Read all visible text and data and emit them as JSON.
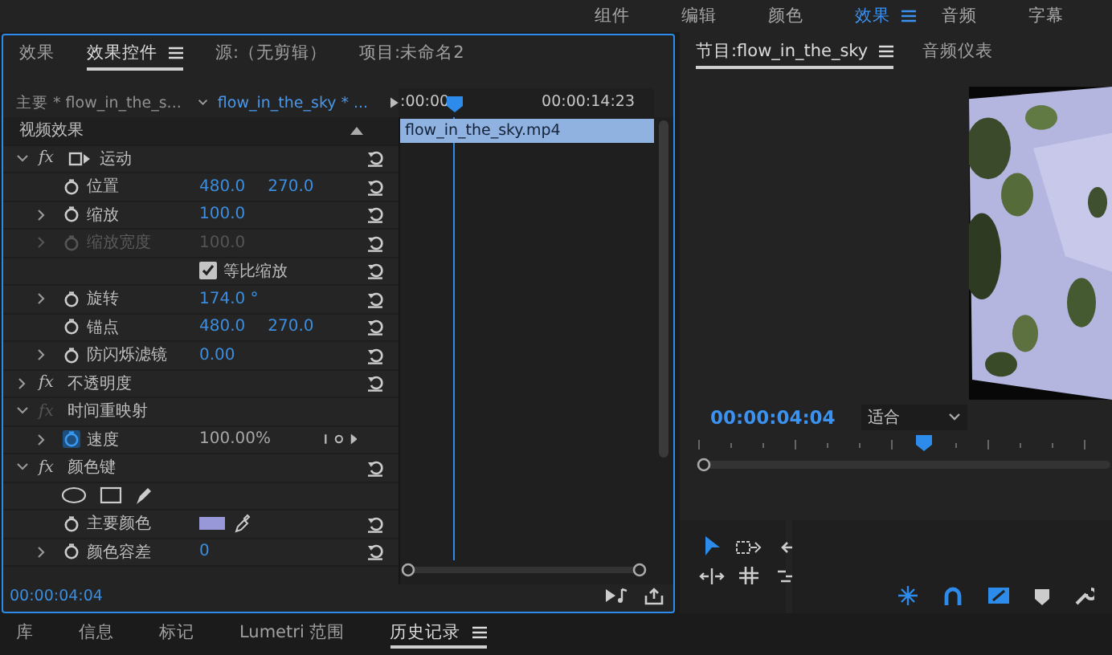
{
  "workspaces": [
    {
      "label": "组件",
      "selected": false
    },
    {
      "label": "编辑",
      "selected": false
    },
    {
      "label": "颜色",
      "selected": false
    },
    {
      "label": "效果",
      "selected": true
    },
    {
      "label": "音频",
      "selected": false
    },
    {
      "label": "字幕",
      "selected": false
    }
  ],
  "effect_panel": {
    "tabs": [
      {
        "label": "效果",
        "selected": false
      },
      {
        "label": "效果控件",
        "selected": true
      },
      {
        "label": "源:（无剪辑）",
        "selected": false
      },
      {
        "label": "项目:未命名2",
        "selected": false
      }
    ],
    "master_clip": "主要 * flow_in_the_s...",
    "sequence_clip": "flow_in_the_sky * ...",
    "ruler_start": ":00:00",
    "ruler_end": "00:00:14:23",
    "clip_name": "flow_in_the_sky.mp4",
    "rows": [
      {
        "kind": "header",
        "label": "视频效果"
      },
      {
        "kind": "effect",
        "label": "运动",
        "badge": "fx",
        "expanded": true,
        "fx_active": true,
        "transform": true,
        "reset": true
      },
      {
        "kind": "param",
        "label": "位置",
        "values": [
          "480.0",
          "270.0"
        ],
        "keyframing": false,
        "disabled": false,
        "reset": true
      },
      {
        "kind": "param",
        "label": "缩放",
        "expanded": false,
        "values": [
          "100.0"
        ],
        "keyframing": false,
        "disabled": false,
        "reset": true
      },
      {
        "kind": "param",
        "label": "缩放宽度",
        "expanded": false,
        "values": [
          "100.0"
        ],
        "keyframing": false,
        "disabled": true,
        "reset": true
      },
      {
        "kind": "checkbox",
        "label": "等比缩放",
        "checked": true,
        "reset": true
      },
      {
        "kind": "param",
        "label": "旋转",
        "expanded": false,
        "values": [
          "174.0 °"
        ],
        "keyframing": false,
        "disabled": false,
        "reset": true
      },
      {
        "kind": "param",
        "label": "锚点",
        "values": [
          "480.0",
          "270.0"
        ],
        "keyframing": false,
        "disabled": false,
        "reset": true
      },
      {
        "kind": "param",
        "label": "防闪烁滤镜",
        "expanded": false,
        "values": [
          "0.00"
        ],
        "keyframing": false,
        "disabled": false,
        "reset": true
      },
      {
        "kind": "effect",
        "label": "不透明度",
        "badge": "fx",
        "expanded": false,
        "fx_active": true,
        "transform": false,
        "reset": true
      },
      {
        "kind": "effect",
        "label": "时间重映射",
        "badge": "fx",
        "expanded": true,
        "fx_active": false,
        "transform": false,
        "reset": false
      },
      {
        "kind": "speed",
        "label": "速度",
        "expanded": false,
        "values": [
          "100.00%"
        ],
        "keyframing": true,
        "reset": false
      },
      {
        "kind": "effect",
        "label": "颜色键",
        "badge": "fx",
        "expanded": true,
        "fx_active": true,
        "transform": false,
        "reset": true
      },
      {
        "kind": "mask_tools"
      },
      {
        "kind": "color",
        "label": "主要颜色",
        "color": "#9898d8",
        "reset": true
      },
      {
        "kind": "param",
        "label": "颜色容差",
        "expanded": false,
        "values": [
          "0"
        ],
        "keyframing": false,
        "disabled": false,
        "reset": true
      }
    ],
    "timecode": "00:00:04:04"
  },
  "program_panel": {
    "tabs": [
      {
        "label": "节目:flow_in_the_sky",
        "selected": true
      },
      {
        "label": "音频仪表",
        "selected": false
      }
    ],
    "timecode": "00:00:04:04",
    "zoom": "适合"
  },
  "bottom_tabs": [
    {
      "label": "库",
      "selected": false
    },
    {
      "label": "信息",
      "selected": false
    },
    {
      "label": "标记",
      "selected": false
    },
    {
      "label": "Lumetri 范围",
      "selected": false
    },
    {
      "label": "历史记录",
      "selected": true
    }
  ]
}
